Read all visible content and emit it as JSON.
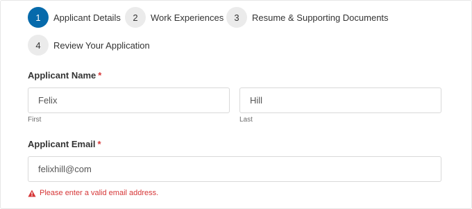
{
  "steps": [
    {
      "number": "1",
      "label": "Applicant Details",
      "active": true
    },
    {
      "number": "2",
      "label": "Work Experiences",
      "active": false
    },
    {
      "number": "3",
      "label": "Resume & Supporting Documents",
      "active": false
    },
    {
      "number": "4",
      "label": "Review Your Application",
      "active": false
    }
  ],
  "name_field": {
    "label": "Applicant Name",
    "required_mark": "*",
    "first": {
      "value": "Felix",
      "sublabel": "First"
    },
    "last": {
      "value": "Hill",
      "sublabel": "Last"
    }
  },
  "email_field": {
    "label": "Applicant Email",
    "required_mark": "*",
    "value": "felixhill@com",
    "error": "Please enter a valid email address."
  },
  "colors": {
    "accent": "#066aab",
    "error": "#d63637"
  },
  "icons": {
    "error": "warning-triangle-icon"
  }
}
